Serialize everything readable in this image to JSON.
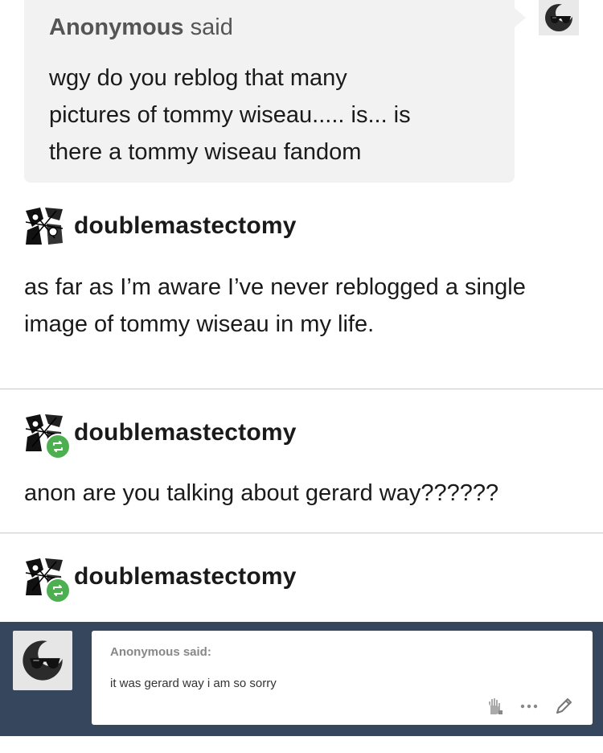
{
  "ask": {
    "asker_name": "Anonymous",
    "said_word": "said",
    "question_lines": [
      "wgy do you reblog that many",
      "pictures of tommy wiseau..... is... is",
      "there a tommy wiseau fandom"
    ]
  },
  "posts": [
    {
      "username": "doublemastectomy",
      "reblog": false,
      "body_lines": [
        "as far as I’m aware I’ve never reblogged a single",
        "image of tommy wiseau in my life."
      ]
    },
    {
      "username": "doublemastectomy",
      "reblog": true,
      "body_lines": [
        "anon are you talking about gerard way??????"
      ]
    },
    {
      "username": "doublemastectomy",
      "reblog": true,
      "body_lines": []
    }
  ],
  "dashboard_ask": {
    "asker_label": "Anonymous said:",
    "question": "it was gerard way i am so sorry",
    "icons": [
      "hand-icon",
      "more-icon",
      "edit-icon"
    ]
  },
  "colors": {
    "panel": "#36465d",
    "bubble": "#f2f2f2",
    "reblog_green": "#4caf50"
  }
}
